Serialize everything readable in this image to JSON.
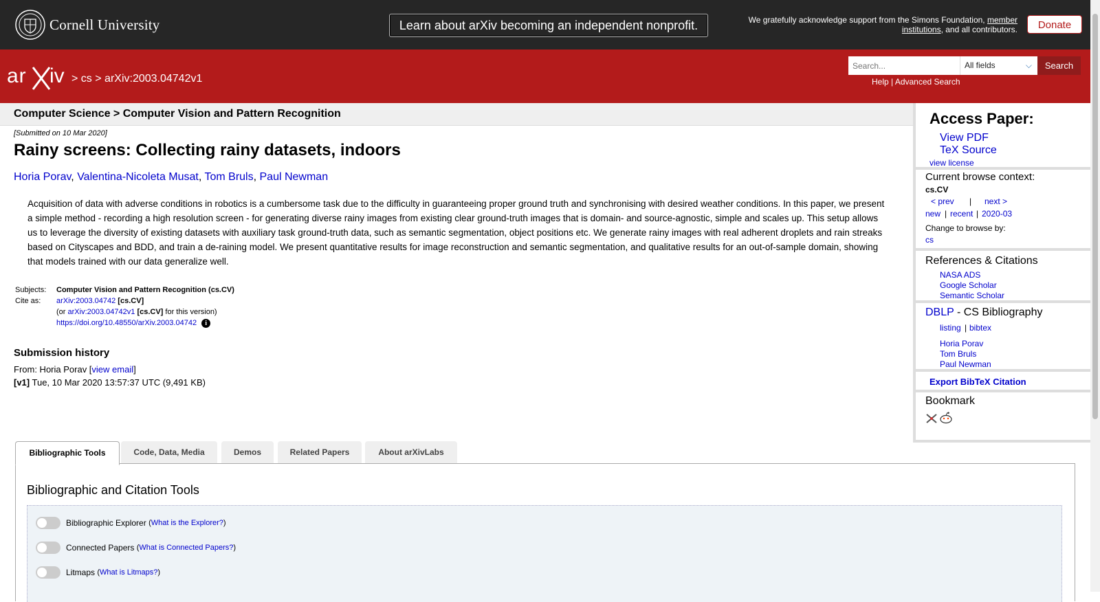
{
  "header": {
    "institution": "Cornell University",
    "banner": "Learn about arXiv becoming an independent nonprofit.",
    "support_pre": "We gratefully acknowledge support from the Simons Foundation,",
    "support_link": "member institutions",
    "support_post": ", and all contributors.",
    "donate": "Donate"
  },
  "nav": {
    "sep1": ">",
    "cs": "cs",
    "sep2": ">",
    "paper_id": "arXiv:2003.04742v1",
    "search_placeholder": "Search...",
    "search_field": "All fields",
    "search_button": "Search",
    "help": "Help",
    "pipe": "|",
    "advanced": "Advanced Search"
  },
  "category": "Computer Science > Computer Vision and Pattern Recognition",
  "paper": {
    "submitted": "[Submitted on 10 Mar 2020]",
    "title": "Rainy screens: Collecting rainy datasets, indoors",
    "authors": [
      "Horia Porav",
      "Valentina-Nicoleta Musat",
      "Tom Bruls",
      "Paul Newman"
    ],
    "abstract": "Acquisition of data with adverse conditions in robotics is a cumbersome task due to the difficulty in guaranteeing proper ground truth and synchronising with desired weather conditions. In this paper, we present a simple method - recording a high resolution screen - for generating diverse rainy images from existing clear ground-truth images that is domain- and source-agnostic, simple and scales up. This setup allows us to leverage the diversity of existing datasets with auxiliary task ground-truth data, such as semantic segmentation, object positions etc. We generate rainy images with real adherent droplets and rain streaks based on Cityscapes and BDD, and train a de-raining model. We present quantitative results for image reconstruction and semantic segmentation, and qualitative results for an out-of-sample domain, showing that models trained with our data generalize well.",
    "subjects_label": "Subjects:",
    "subjects": "Computer Vision and Pattern Recognition (cs.CV)",
    "cite_label": "Cite as:",
    "cite_id": "arXiv:2003.04742",
    "cite_cat": "[cs.CV]",
    "or_pre": "(or",
    "cite_v_id": "arXiv:2003.04742v1",
    "or_post": "for this version)",
    "doi": "https://doi.org/10.48550/arXiv.2003.04742",
    "history_heading": "Submission history",
    "from_pre": "From: Horia Porav [",
    "view_email": "view email",
    "from_post": "]",
    "v1_label": "[v1]",
    "v1_text": "Tue, 10 Mar 2020 13:57:37 UTC (9,491 KB)"
  },
  "sidebar": {
    "access_heading": "Access Paper:",
    "view_pdf": "View PDF",
    "tex_source": "TeX Source",
    "view_license": "view license",
    "context_heading": "Current browse context:",
    "context": "cs.CV",
    "prev": "< prev",
    "pipe": "|",
    "next": "next >",
    "new": "new",
    "recent": "recent",
    "month": "2020-03",
    "change_label": "Change to browse by:",
    "browse_cs": "cs",
    "refs_heading": "References & Citations",
    "nasa": "NASA ADS",
    "google": "Google Scholar",
    "semantic": "Semantic Scholar",
    "dblp": "DBLP",
    "dblp_suffix": " - CS Bibliography",
    "listing": "listing",
    "bibtex": "bibtex",
    "dblp_authors": [
      "Horia Porav",
      "Tom Bruls",
      "Paul Newman"
    ],
    "export": "Export BibTeX Citation",
    "bookmark_heading": "Bookmark"
  },
  "tabs": [
    "Bibliographic Tools",
    "Code, Data, Media",
    "Demos",
    "Related Papers",
    "About arXivLabs"
  ],
  "tools": {
    "heading": "Bibliographic and Citation Tools",
    "items": [
      {
        "label": "Bibliographic Explorer",
        "link": "What is the Explorer?"
      },
      {
        "label": "Connected Papers",
        "link": "What is Connected Papers?"
      },
      {
        "label": "Litmaps",
        "link": "What is Litmaps?"
      }
    ]
  }
}
